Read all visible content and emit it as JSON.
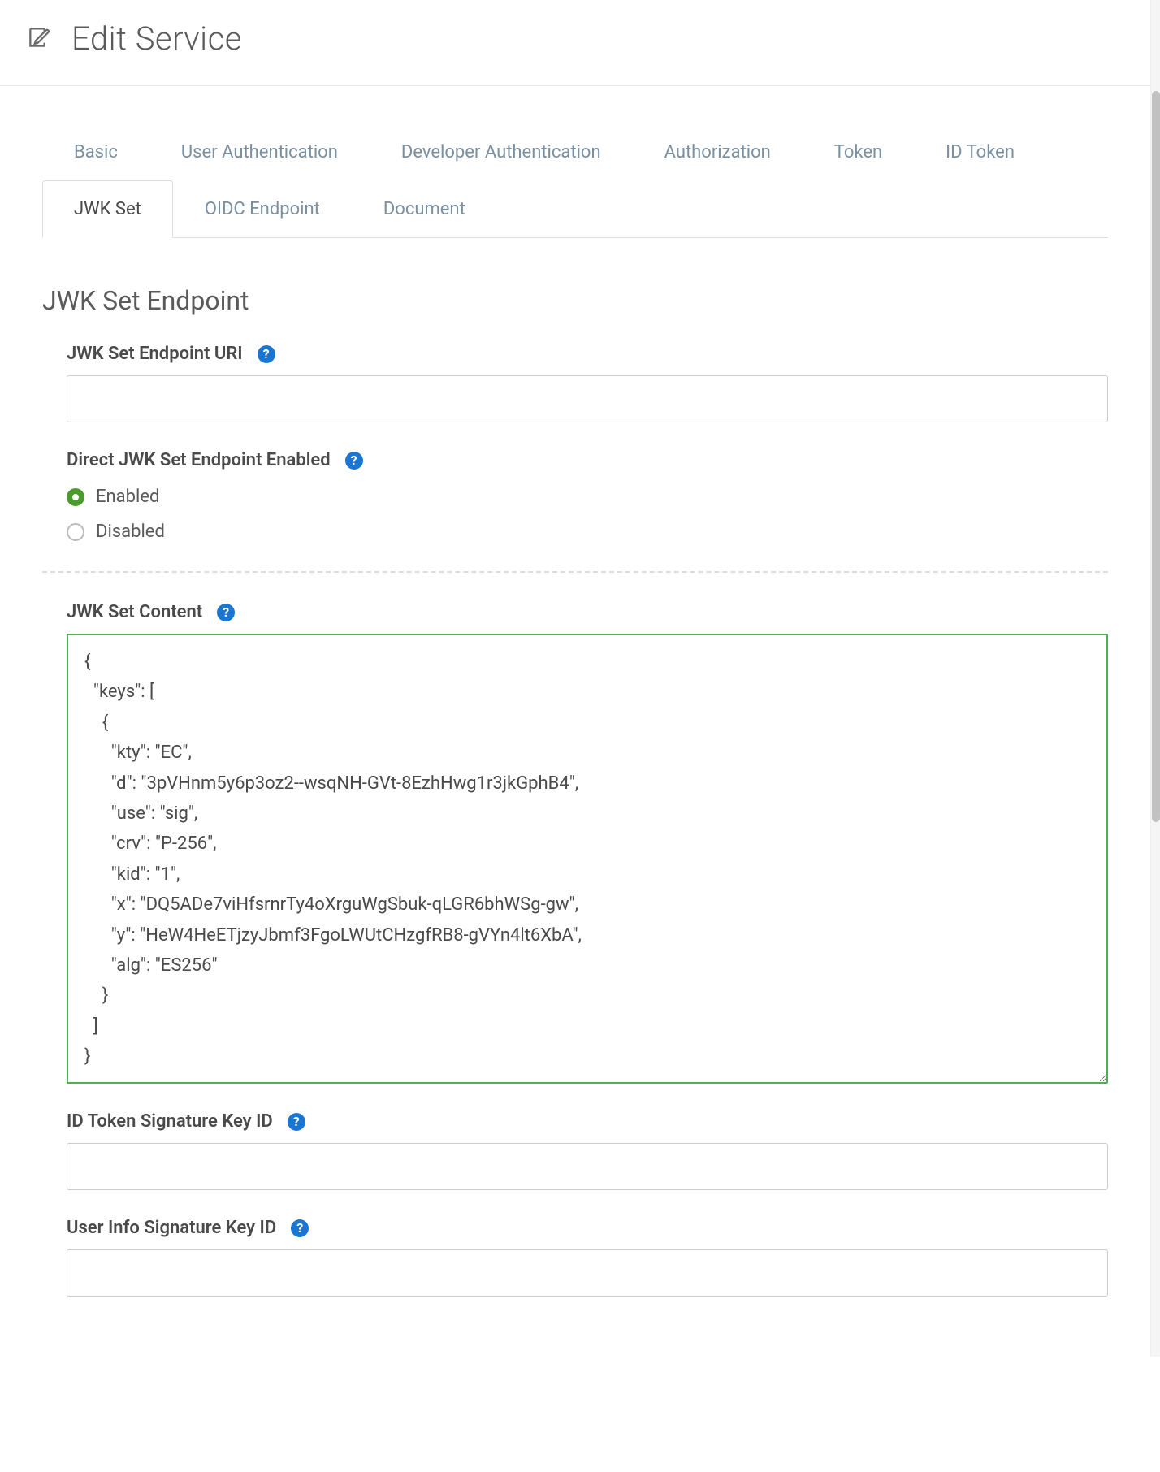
{
  "header": {
    "title": "Edit Service"
  },
  "tabs": {
    "row1": [
      {
        "id": "basic",
        "label": "Basic",
        "active": false
      },
      {
        "id": "user-auth",
        "label": "User Authentication",
        "active": false
      },
      {
        "id": "dev-auth",
        "label": "Developer Authentication",
        "active": false
      },
      {
        "id": "authorization",
        "label": "Authorization",
        "active": false
      }
    ],
    "row2": [
      {
        "id": "token",
        "label": "Token",
        "active": false
      },
      {
        "id": "id-token",
        "label": "ID Token",
        "active": false
      },
      {
        "id": "jwk-set",
        "label": "JWK Set",
        "active": true
      },
      {
        "id": "oidc-endpoint",
        "label": "OIDC Endpoint",
        "active": false
      },
      {
        "id": "document",
        "label": "Document",
        "active": false
      }
    ]
  },
  "section": {
    "title": "JWK Set Endpoint"
  },
  "fields": {
    "endpoint_uri": {
      "label": "JWK Set Endpoint URI",
      "value": ""
    },
    "direct_enabled": {
      "label": "Direct JWK Set Endpoint Enabled",
      "options": {
        "enabled": "Enabled",
        "disabled": "Disabled"
      },
      "selected": "enabled"
    },
    "jwk_content": {
      "label": "JWK Set Content",
      "value": "{\n  \"keys\": [\n    {\n      \"kty\": \"EC\",\n      \"d\": \"3pVHnm5y6p3oz2--wsqNH-GVt-8EzhHwg1r3jkGphB4\",\n      \"use\": \"sig\",\n      \"crv\": \"P-256\",\n      \"kid\": \"1\",\n      \"x\": \"DQ5ADe7viHfsrnrTy4oXrguWgSbuk-qLGR6bhWSg-gw\",\n      \"y\": \"HeW4HeETjzyJbmf3FgoLWUtCHzgfRB8-gVYn4lt6XbA\",\n      \"alg\": \"ES256\"\n    }\n  ]\n}"
    },
    "id_token_sig_key": {
      "label": "ID Token Signature Key ID",
      "value": ""
    },
    "userinfo_sig_key": {
      "label": "User Info Signature Key ID",
      "value": ""
    }
  }
}
